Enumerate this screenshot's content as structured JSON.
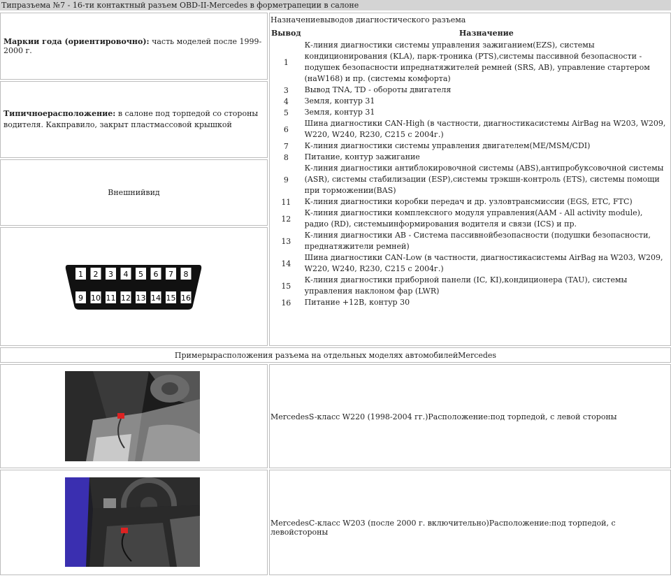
{
  "header": {
    "title": "Типразъема №7 - 16-ти контактный разъем OBD-II-Mercedes в форметрапеции в салоне"
  },
  "left": {
    "years_label": "Маркии года (ориентировочно):",
    "years_value": " часть моделей после 1999-2000 г.",
    "location_label": "Типичноерасположение:",
    "location_value": " в салоне под торпедой со стороны водителя. Какправило, закрыт пластмассовой крышкой",
    "appearance_label": "Внешнийвид"
  },
  "connector": {
    "pins_top": [
      "1",
      "2",
      "3",
      "4",
      "5",
      "6",
      "7",
      "8"
    ],
    "pins_bottom": [
      "9",
      "10",
      "11",
      "12",
      "13",
      "14",
      "15",
      "16"
    ]
  },
  "pins_table": {
    "title": "Назначениевыводов диагностического разъема",
    "col_pin": "Вывод",
    "col_purpose": "Назначение",
    "rows": [
      {
        "pin": "1",
        "color": "#1a1aff",
        "text": "К-линия диагностики системы управления зажиганием(EZS), системы кондиционирования (KLA), парк-троника (PTS),системы пассивной безопасности - подушек безопасности ипреднатяжителей ремней (SRS, AB), управление стартером (наW168) и пр. (системы комфорта)"
      },
      {
        "pin": "3",
        "color": "",
        "text": "Вывод TNA, TD - обороты двигателя"
      },
      {
        "pin": "4",
        "color": "#000000",
        "text": "Земля, контур 31"
      },
      {
        "pin": "5",
        "color": "#000000",
        "text": "Земля, контур 31"
      },
      {
        "pin": "6",
        "color": "",
        "text": "Шина диагностики CAN-High (в частности, диагностикасистемы AirBag на W203, W209, W220, W240, R230, C215 с 2004г.)"
      },
      {
        "pin": "7",
        "color": "#1a1aff",
        "text": "К-линия диагностики системы управления двигателем(ME/MSM/CDI)"
      },
      {
        "pin": "8",
        "color": "#e01010",
        "text": "Питание, контур зажигание"
      },
      {
        "pin": "9",
        "color": "#1a1aff",
        "text": "К-линия диагностики антиблокировочной системы (ABS),антипробуксовочной системы (ASR), системы стабилизации (ESP),системы трэкшн-контроль (ETS), системы помощи при торможении(BAS)"
      },
      {
        "pin": "11",
        "color": "#1a1aff",
        "text": "К-линия диагностики коробки передач и др. узловтрансмиссии (EGS, ETC, FTC)"
      },
      {
        "pin": "12",
        "color": "#1a1aff",
        "text": "К-линия диагностики комплексного модуля управления(AAM - All activity module), радио (RD), системыинформирования водителя и связи (ICS) и пр."
      },
      {
        "pin": "13",
        "color": "#1a1aff",
        "text": "К-линия диагностики AB - Система пассивнойбезопасности (подушки безопасности, преднатяжители ремней)"
      },
      {
        "pin": "14",
        "color": "",
        "text": "Шина диагностики CAN-Low (в частности, диагностикасистемы AirBag на W203, W209, W220, W240, R230, C215 с 2004г.)"
      },
      {
        "pin": "15",
        "color": "#1a1aff",
        "text": "К-линия диагностики приборной панели (IC, KI),кондиционера (TAU), системы управления наклоном фар (LWR)"
      },
      {
        "pin": "16",
        "color": "#e01010",
        "text": "Питание +12В, контур 30"
      }
    ]
  },
  "examples": {
    "title": "Примерырасположения разъема на отдельных моделях автомобилейMercedes",
    "items": [
      {
        "caption": "MercedesS-класс W220 (1998-2004 гг.)Расположение:под торпедой, с левой стороны"
      },
      {
        "caption": "MercedesC-класс W203 (после 2000 г. включительно)Расположение:под торпедой, с левойстороны"
      }
    ]
  }
}
